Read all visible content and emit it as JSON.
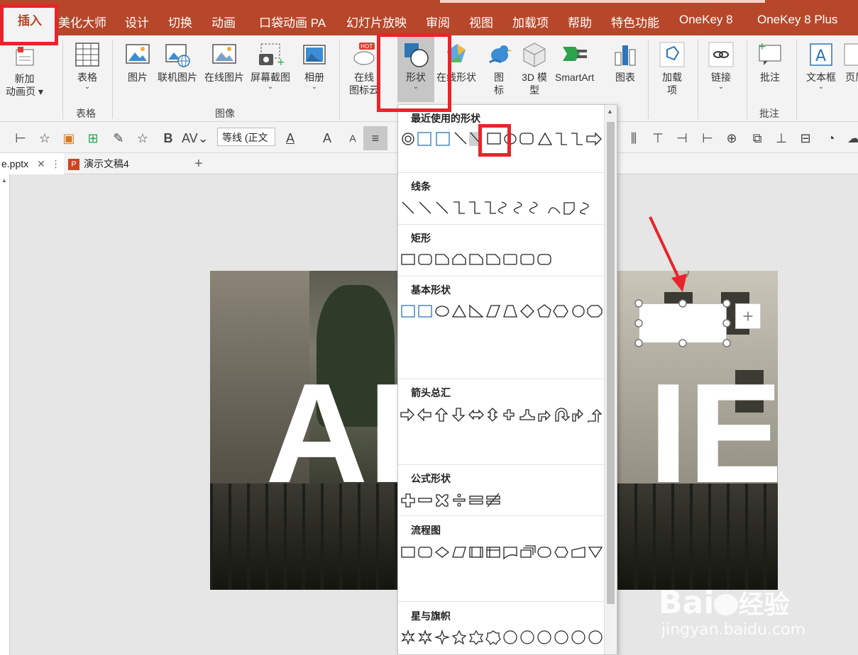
{
  "tabs": {
    "active": "插入",
    "items": [
      "美化大师",
      "设计",
      "切换",
      "动画",
      "口袋动画 PA",
      "幻灯片放映",
      "审阅",
      "视图",
      "加载项",
      "帮助",
      "特色功能",
      "OneKey 8",
      "OneKey 8 Plus"
    ]
  },
  "ribbon": {
    "new_slide_line1": "新加",
    "new_slide_line2": "动画页 ▾",
    "table": "表格",
    "table_group": "表格",
    "picture": "图片",
    "online_picture": "联机图片",
    "online_picture2": "在线图片",
    "screenshot": "屏幕截图",
    "album": "相册",
    "image_group": "图像",
    "hot_badge": "HOT",
    "online_icons_line1": "在线",
    "online_icons_line2": "图标云",
    "shapes": "形状",
    "online_shapes": "在线形状",
    "icons_line1": "图",
    "icons_line2": "标",
    "model_line1": "3D 模",
    "model_line2": "型",
    "smartart": "SmartArt",
    "chart": "图表",
    "addins_line1": "加载",
    "addins_line2": "项",
    "link": "链接",
    "comment": "批注",
    "comment_group": "批注",
    "textbox": "文本框",
    "header_footer": "页眉"
  },
  "format_toolbar": {
    "bold": "B",
    "font_name": "等线 (正文",
    "font_color_letter": "A",
    "grow_font": "A",
    "shrink_font": "A"
  },
  "doc_tabs": {
    "file1": "e.pptx",
    "file2": "演示文稿4",
    "add": "+"
  },
  "slide": {
    "text_left": "AL",
    "text_right": "IE"
  },
  "shapes_menu": {
    "sections": [
      "最近使用的形状",
      "线条",
      "矩形",
      "基本形状",
      "箭头总汇",
      "公式形状",
      "流程图",
      "星与旗帜"
    ]
  },
  "watermark": {
    "brand": "Bai",
    "brand_cn": "经验",
    "url": "jingyan.baidu.com"
  },
  "colors": {
    "ribbon_red": "#b7472a",
    "highlight_red": "#e8242a",
    "icon_blue": "#2e75b6"
  }
}
